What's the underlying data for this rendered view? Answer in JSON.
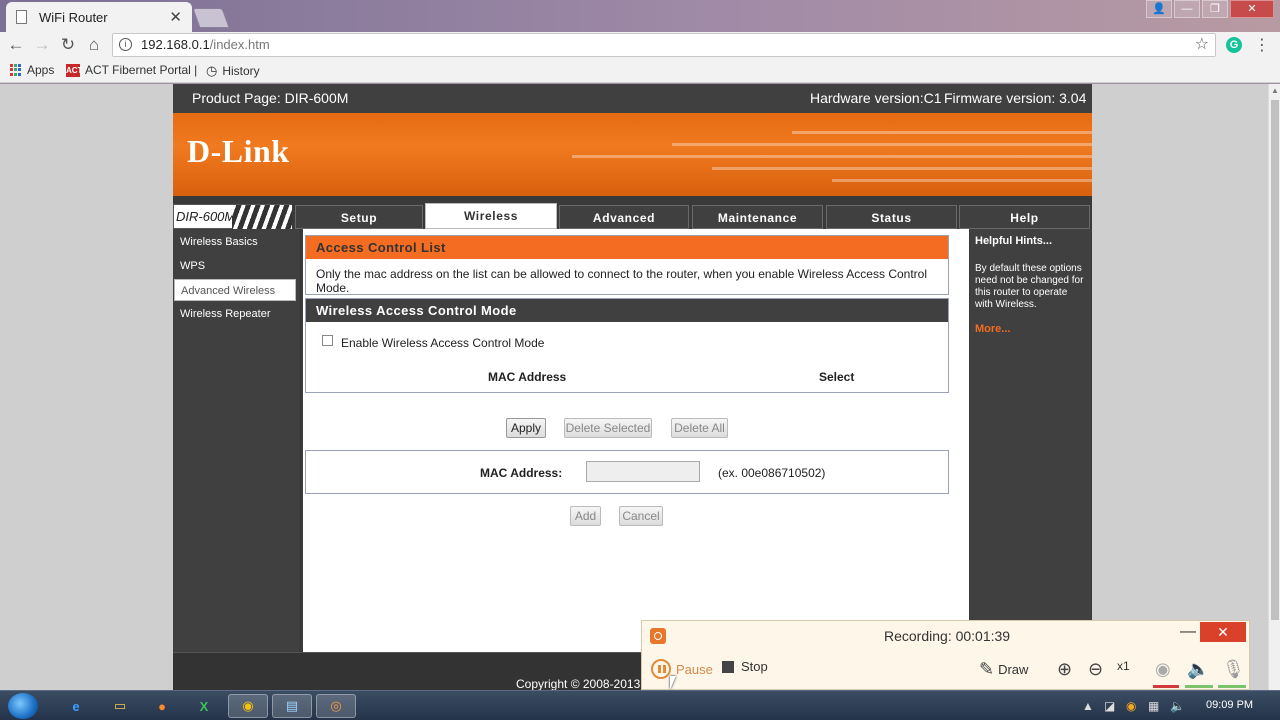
{
  "browser": {
    "tab_title": "WiFi Router",
    "tab_close": "✕",
    "url_host": "192.168.0.1",
    "url_path": "/index.htm",
    "window_controls": {
      "user": "👤",
      "minimize": "—",
      "restore": "❐",
      "close": "✕"
    },
    "bookmarks": [
      {
        "label": "Apps",
        "icon": "apps-grid-icon"
      },
      {
        "label": "ACT Fibernet Portal |",
        "icon": "act-logo-icon"
      },
      {
        "label": "History",
        "icon": "history-icon"
      }
    ]
  },
  "router": {
    "product_page": "Product Page: DIR-600M",
    "hardware_version": "Hardware version:C1",
    "firmware_version": "Firmware version: 3.04",
    "logo": "D-Link",
    "model": "DIR-600M",
    "tabs": [
      {
        "label": "Setup",
        "active": false
      },
      {
        "label": "Wireless",
        "active": true
      },
      {
        "label": "Advanced",
        "active": false
      },
      {
        "label": "Maintenance",
        "active": false
      },
      {
        "label": "Status",
        "active": false
      },
      {
        "label": "Help",
        "active": false
      }
    ],
    "sidebar": [
      {
        "label": "Wireless Basics",
        "active": false
      },
      {
        "label": "WPS",
        "active": false
      },
      {
        "label": "Advanced Wireless",
        "active": true
      },
      {
        "label": "Wireless Repeater",
        "active": false
      }
    ],
    "acl": {
      "title": "Access Control List",
      "description": "Only the mac address on the list can be allowed to connect to the router, when you enable Wireless Access Control Mode."
    },
    "mode": {
      "title": "Wireless Access Control Mode",
      "checkbox_label": "Enable Wireless Access Control Mode",
      "checkbox_checked": false,
      "col_mac": "MAC Address",
      "col_select": "Select"
    },
    "buttons": {
      "apply": "Apply",
      "delete_selected": "Delete Selected",
      "delete_all": "Delete All",
      "add": "Add",
      "cancel": "Cancel"
    },
    "mac_form": {
      "label": "MAC Address:",
      "value": "",
      "example": "(ex. 00e086710502)"
    },
    "hints": {
      "title": "Helpful Hints...",
      "body": "By default these options need not be changed for this router to operate with Wireless.",
      "more": "More..."
    },
    "copyright": "Copyright © 2008-2013"
  },
  "recorder": {
    "title": "Recording:",
    "time": "00:01:39",
    "pause": "Pause",
    "stop": "Stop",
    "draw": "Draw",
    "zoom_level": "x1",
    "minimize": "—",
    "close": "✕"
  },
  "taskbar": {
    "clock": "09:09 PM",
    "apps": [
      {
        "name": "ie-icon",
        "glyph": "e"
      },
      {
        "name": "explorer-icon",
        "glyph": "▭"
      },
      {
        "name": "firefox-icon",
        "glyph": "●"
      },
      {
        "name": "excel-icon",
        "glyph": "X"
      },
      {
        "name": "chrome-icon",
        "glyph": "◉"
      },
      {
        "name": "notepad-icon",
        "glyph": "▤"
      },
      {
        "name": "recorder-icon",
        "glyph": "◎"
      }
    ]
  },
  "colors": {
    "dlink_orange": "#f36c21",
    "dark_panel": "#404040",
    "recorder_bg": "#fdf6e9"
  }
}
